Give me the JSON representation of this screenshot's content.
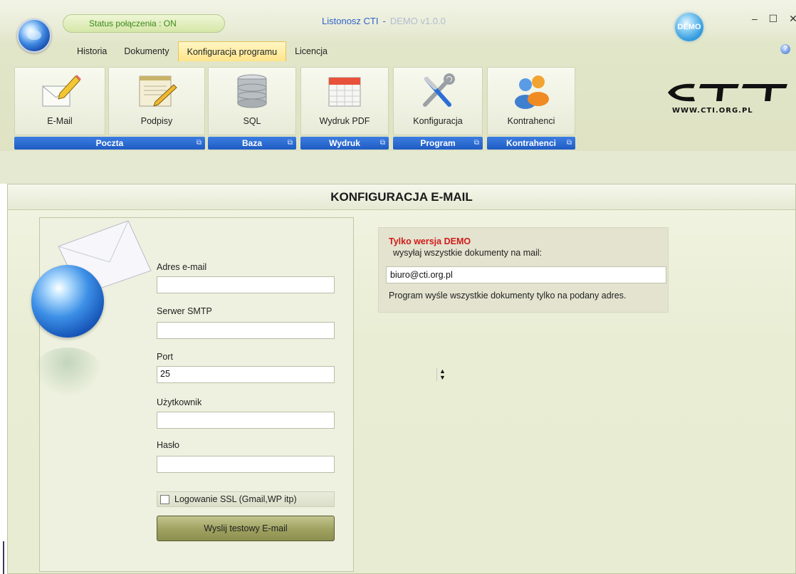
{
  "window": {
    "status": "Status połączenia : ON",
    "title": "Listonosz CTI",
    "title_sep": "-",
    "version": "DEMO v1.0.0",
    "demo_badge": "DEMO",
    "controls": "– ☐ ✕",
    "help": "?"
  },
  "tabs": [
    {
      "label": "Historia",
      "active": false
    },
    {
      "label": "Dokumenty",
      "active": false
    },
    {
      "label": "Konfiguracja programu",
      "active": true
    },
    {
      "label": "Licencja",
      "active": false
    }
  ],
  "ribbon": {
    "groups": [
      {
        "name": "Poczta",
        "buttons": [
          {
            "label": "E-Mail",
            "icon": "email-edit-icon"
          },
          {
            "label": "Podpisy",
            "icon": "signature-pen-icon"
          }
        ]
      },
      {
        "name": "Baza",
        "buttons": [
          {
            "label": "SQL",
            "icon": "database-icon"
          }
        ]
      },
      {
        "name": "Wydruk",
        "buttons": [
          {
            "label": "Wydruk PDF",
            "icon": "calendar-icon"
          }
        ]
      },
      {
        "name": "Program",
        "buttons": [
          {
            "label": "Konfiguracja",
            "icon": "tools-icon"
          }
        ]
      },
      {
        "name": "Kontrahenci",
        "buttons": [
          {
            "label": "Kontrahenci",
            "icon": "users-icon"
          }
        ]
      }
    ],
    "launcher_glyph": "⧉"
  },
  "logo": {
    "url": "WWW.CTI.ORG.PL"
  },
  "page": {
    "title": "KONFIGURACJA E-MAIL"
  },
  "form": {
    "email_label": "Adres e-mail",
    "email_value": "",
    "smtp_label": "Serwer SMTP",
    "smtp_value": "",
    "port_label": "Port",
    "port_value": "25",
    "user_label": "Użytkownik",
    "user_value": "",
    "password_label": "Hasło",
    "password_value": "",
    "ssl_label": "Logowanie SSL (Gmail,WP itp)",
    "ssl_checked": false,
    "send_label": "Wyslij testowy E-mail"
  },
  "demo": {
    "title": "Tylko wersja DEMO",
    "subtitle": "wysyłaj wszystkie dokumenty na mail:",
    "email": "biuro@cti.org.pl",
    "note": "Program wyśle wszystkie dokumenty tylko na podany adres."
  },
  "colors": {
    "accent_blue": "#2f62c9",
    "group_bar": "#2a6ad6",
    "demo_red": "#d11a1a",
    "status_green": "#3b8a1a"
  }
}
